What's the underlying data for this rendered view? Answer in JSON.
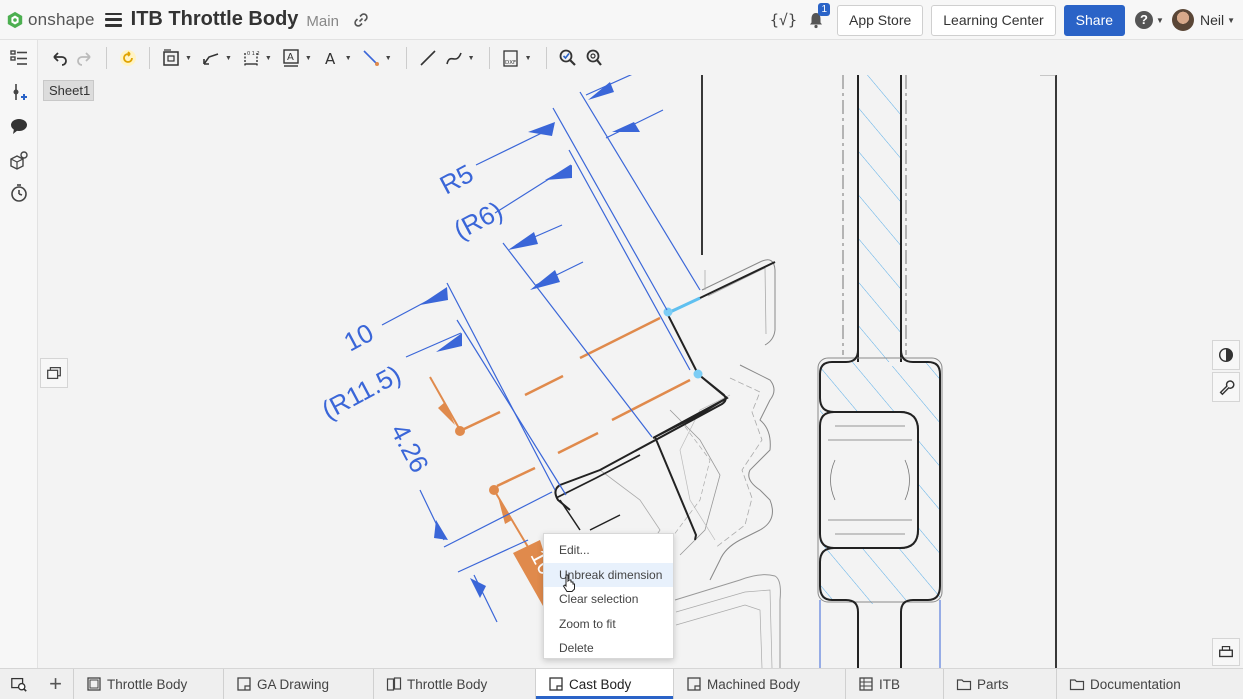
{
  "app": {
    "brand": "onshape",
    "document_title": "ITB Throttle Body",
    "workspace": "Main"
  },
  "header": {
    "variables_label": "{√}",
    "notifications_count": "1",
    "app_store_label": "App Store",
    "learning_center_label": "Learning Center",
    "share_label": "Share",
    "help_label": "?",
    "user_name": "Neil"
  },
  "sheet": {
    "label": "Sheet1"
  },
  "dimensions": {
    "r5": "R5",
    "r6": "(R6)",
    "d10": "10",
    "r11_5": "(R11.5)",
    "d4_26": "4.26",
    "selected": "10"
  },
  "context_menu": {
    "items": [
      "Edit...",
      "Unbreak dimension",
      "Clear selection",
      "Zoom to fit",
      "Delete"
    ],
    "highlighted_index": 1
  },
  "tabs": [
    {
      "label": "Throttle Body",
      "icon": "part-studio-icon",
      "active": false
    },
    {
      "label": "GA Drawing",
      "icon": "drawing-icon",
      "active": false
    },
    {
      "label": "Throttle Body",
      "icon": "assembly-icon",
      "active": false
    },
    {
      "label": "Cast Body",
      "icon": "drawing-icon",
      "active": true
    },
    {
      "label": "Machined Body",
      "icon": "drawing-icon",
      "active": false
    },
    {
      "label": "ITB",
      "icon": "table-icon",
      "active": false
    },
    {
      "label": "Parts",
      "icon": "folder-icon",
      "active": false
    },
    {
      "label": "Documentation",
      "icon": "folder-icon",
      "active": false
    }
  ],
  "colors": {
    "accent": "#2a63c7",
    "dimension_blue": "#3a66d8",
    "selection_orange": "#e08a4c",
    "hatch_blue": "#5aaee8"
  }
}
